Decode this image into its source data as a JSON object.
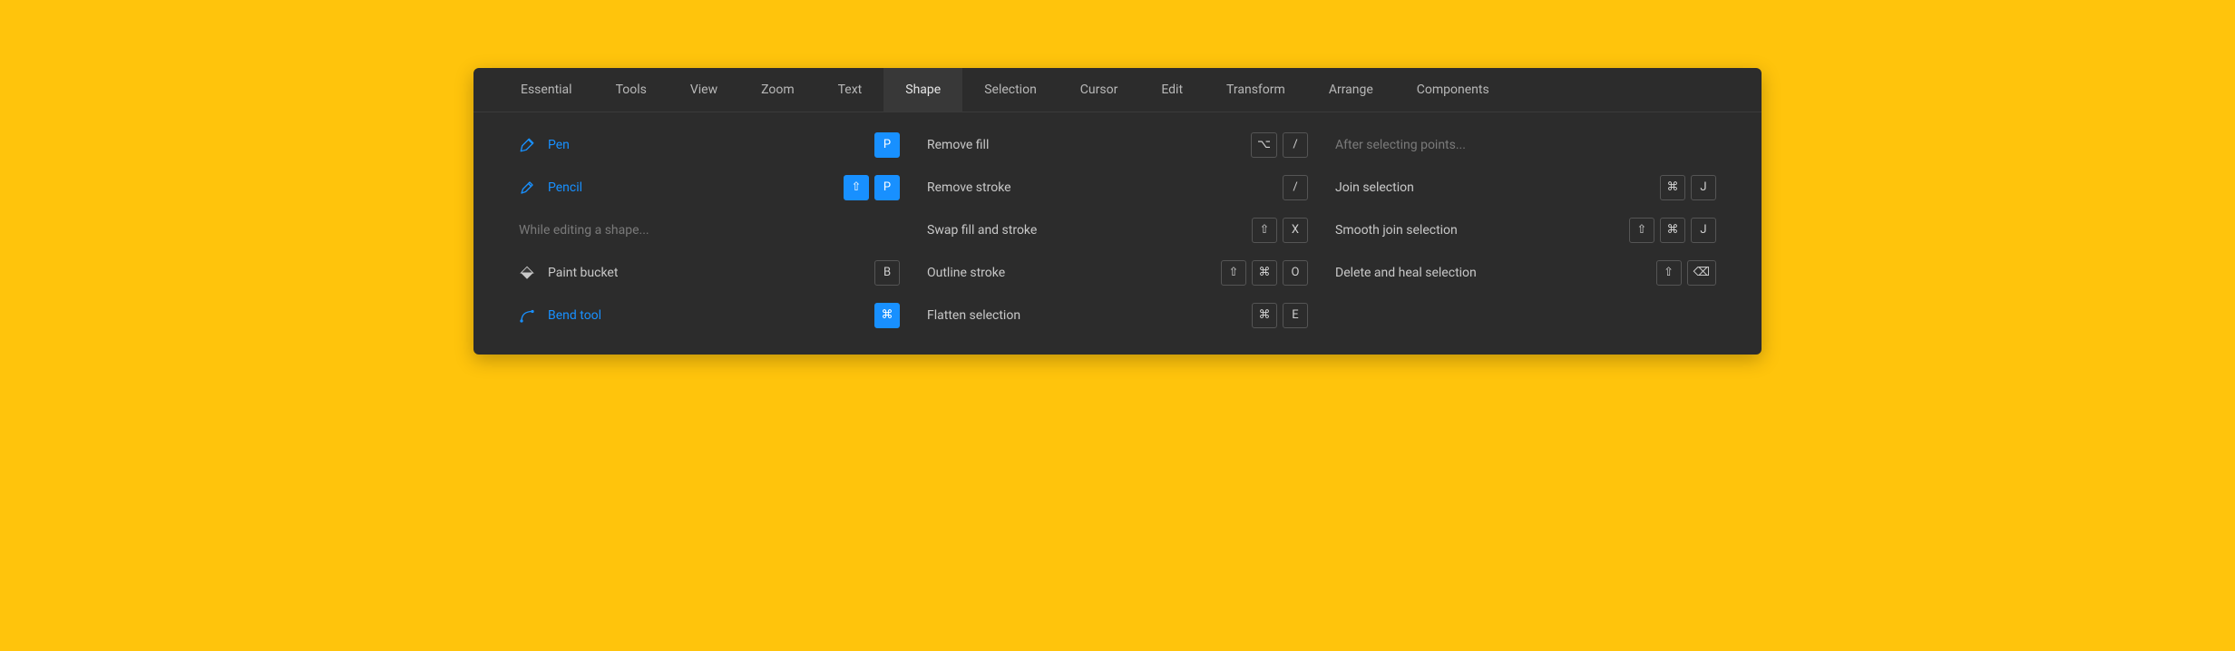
{
  "tabs": {
    "items": [
      {
        "label": "Essential",
        "active": false
      },
      {
        "label": "Tools",
        "active": false
      },
      {
        "label": "View",
        "active": false
      },
      {
        "label": "Zoom",
        "active": false
      },
      {
        "label": "Text",
        "active": false
      },
      {
        "label": "Shape",
        "active": true
      },
      {
        "label": "Selection",
        "active": false
      },
      {
        "label": "Cursor",
        "active": false
      },
      {
        "label": "Edit",
        "active": false
      },
      {
        "label": "Transform",
        "active": false
      },
      {
        "label": "Arrange",
        "active": false
      },
      {
        "label": "Components",
        "active": false
      }
    ]
  },
  "col0": {
    "pen": {
      "label": "Pen",
      "key0": "P"
    },
    "pencil": {
      "label": "Pencil",
      "key0": "⇧",
      "key1": "P"
    },
    "header": "While editing a shape...",
    "paint": {
      "label": "Paint bucket",
      "key0": "B"
    },
    "bend": {
      "label": "Bend tool",
      "key0": "⌘"
    }
  },
  "col1": {
    "removefill": {
      "label": "Remove fill",
      "key0": "⌥",
      "key1": "/"
    },
    "removestroke": {
      "label": "Remove stroke",
      "key0": "/"
    },
    "swap": {
      "label": "Swap fill and stroke",
      "key0": "⇧",
      "key1": "X"
    },
    "outline": {
      "label": "Outline stroke",
      "key0": "⇧",
      "key1": "⌘",
      "key2": "O"
    },
    "flatten": {
      "label": "Flatten selection",
      "key0": "⌘",
      "key1": "E"
    }
  },
  "col2": {
    "header": "After selecting points...",
    "join": {
      "label": "Join selection",
      "key0": "⌘",
      "key1": "J"
    },
    "smooth": {
      "label": "Smooth join selection",
      "key0": "⇧",
      "key1": "⌘",
      "key2": "J"
    },
    "delete": {
      "label": "Delete and heal selection",
      "key0": "⇧",
      "key1": "⌫"
    }
  }
}
